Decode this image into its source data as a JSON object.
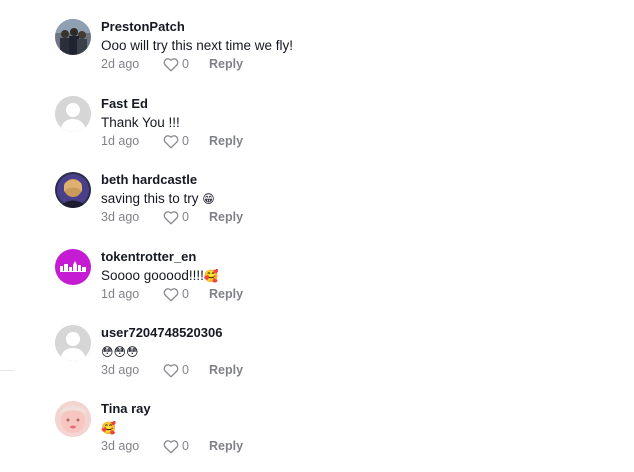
{
  "comments": [
    {
      "username": "PrestonPatch",
      "text": "Ooo will try this next time we fly!",
      "emoji": "",
      "time": "2d ago",
      "likes": "0",
      "reply_label": "Reply",
      "avatar": "photo-group-icon"
    },
    {
      "username": "Fast Ed",
      "text": "Thank You !!!",
      "emoji": "",
      "time": "1d ago",
      "likes": "0",
      "reply_label": "Reply",
      "avatar": "default-user-icon"
    },
    {
      "username": "beth hardcastle",
      "text": "saving this to try ",
      "emoji": "😁",
      "time": "3d ago",
      "likes": "0",
      "reply_label": "Reply",
      "avatar": "photo-portrait-icon"
    },
    {
      "username": "tokentrotter_en",
      "text": "Soooo gooood!!!!",
      "emoji": "🥰",
      "time": "1d ago",
      "likes": "0",
      "reply_label": "Reply",
      "avatar": "skyline-logo-icon"
    },
    {
      "username": "user7204748520306",
      "text": "",
      "emoji": "😳😳😳",
      "time": "3d ago",
      "likes": "0",
      "reply_label": "Reply",
      "avatar": "default-user-icon"
    },
    {
      "username": "Tina ray",
      "text": "",
      "emoji": "🥰",
      "time": "3d ago",
      "likes": "0",
      "reply_label": "Reply",
      "avatar": "photo-face-icon"
    }
  ],
  "colors": {
    "text": "#161823",
    "muted": "#8a8b91",
    "brand_purple": "#c51bd3",
    "default_avatar_bg": "#d6d6d6"
  }
}
